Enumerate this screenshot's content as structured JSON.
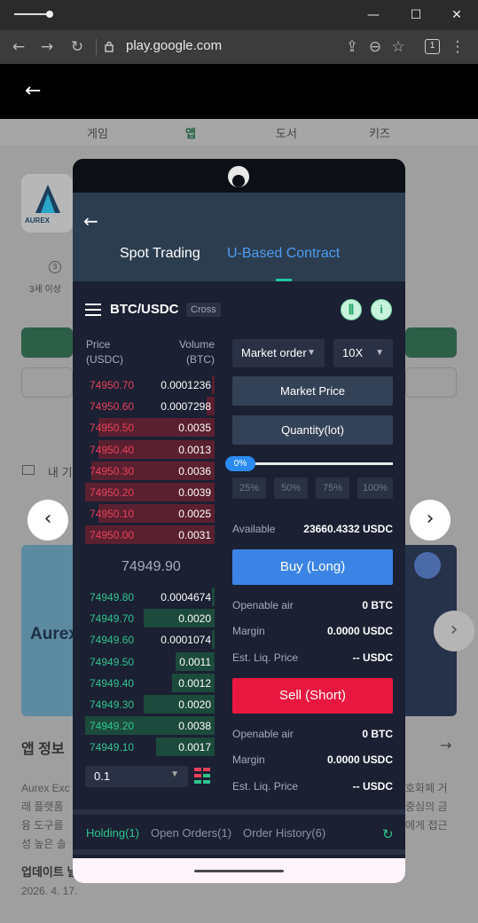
{
  "browser": {
    "url": "play.google.com",
    "tab_count": "1"
  },
  "store": {
    "tabs": [
      "게임",
      "앱",
      "도서",
      "키즈"
    ],
    "rating_label": "3세 이상",
    "section_label": "내 기",
    "app_info_heading": "앱 정보",
    "description_left": "Aurex Exc",
    "description_right": "호화폐 거",
    "description_line2_left": "래 플랫폼",
    "description_line2_right": "중심의 금",
    "description_line3_left": "융 도구를",
    "description_line3_right": "에게 접근",
    "description_line4_left": "성 높은 솔",
    "update_heading": "업데이트 날",
    "update_date": "2026. 4. 17.",
    "banner_text": "Aurex",
    "logo_text": "AUREX"
  },
  "modal": {
    "tabs": {
      "spot": "Spot Trading",
      "ubased": "U-Based Contract"
    },
    "pair": "BTC/USDC",
    "margin_mode": "Cross",
    "orderbook": {
      "price_header_1": "Price",
      "price_header_2": "(USDC)",
      "volume_header_1": "Volume",
      "volume_header_2": "(BTC)",
      "asks": [
        {
          "price": "74950.70",
          "volume": "0.0001236",
          "depth": 0.02
        },
        {
          "price": "74950.60",
          "volume": "0.0007298",
          "depth": 0.06
        },
        {
          "price": "74950.50",
          "volume": "0.0035",
          "depth": 0.9
        },
        {
          "price": "74950.40",
          "volume": "0.0013",
          "depth": 0.9
        },
        {
          "price": "74950.30",
          "volume": "0.0036",
          "depth": 0.95
        },
        {
          "price": "74950.20",
          "volume": "0.0039",
          "depth": 1.0
        },
        {
          "price": "74950.10",
          "volume": "0.0025",
          "depth": 0.9
        },
        {
          "price": "74950.00",
          "volume": "0.0031",
          "depth": 1.0
        }
      ],
      "mid_price": "74949.90",
      "bids": [
        {
          "price": "74949.80",
          "volume": "0.0004674",
          "depth": 0.02
        },
        {
          "price": "74949.70",
          "volume": "0.0020",
          "depth": 0.55
        },
        {
          "price": "74949.60",
          "volume": "0.0001074",
          "depth": 0.02
        },
        {
          "price": "74949.50",
          "volume": "0.0011",
          "depth": 0.3
        },
        {
          "price": "74949.40",
          "volume": "0.0012",
          "depth": 0.33
        },
        {
          "price": "74949.30",
          "volume": "0.0020",
          "depth": 0.55
        },
        {
          "price": "74949.20",
          "volume": "0.0038",
          "depth": 1.0
        },
        {
          "price": "74949.10",
          "volume": "0.0017",
          "depth": 0.45
        }
      ],
      "step": "0.1"
    },
    "order": {
      "type": "Market order",
      "leverage": "10X",
      "price_field": "Market Price",
      "qty_field": "Quantity(lot)",
      "percent": "0%",
      "percent_fill": 0,
      "quick": [
        "25%",
        "50%",
        "75%",
        "100%"
      ],
      "available_label": "Available",
      "available_value": "23660.4332 USDC",
      "buy_label": "Buy (Long)",
      "sell_label": "Sell (Short)",
      "long": {
        "openable_label": "Openable air",
        "openable_value": "0 BTC",
        "margin_label": "Margin",
        "margin_value": "0.0000 USDC",
        "liq_label": "Est. Liq. Price",
        "liq_value": "-- USDC"
      },
      "short": {
        "openable_label": "Openable air",
        "openable_value": "0 BTC",
        "margin_label": "Margin",
        "margin_value": "0.0000 USDC",
        "liq_label": "Est. Liq. Price",
        "liq_value": "-- USDC"
      }
    },
    "bottom_tabs": [
      "Holding(1)",
      "Open Orders(1)",
      "Order History(6)"
    ]
  },
  "colors": {
    "accent_blue": "#3b84e6",
    "sell_red": "#e8173f",
    "ask_red": "#e8415a",
    "bid_green": "#2fc48f"
  }
}
